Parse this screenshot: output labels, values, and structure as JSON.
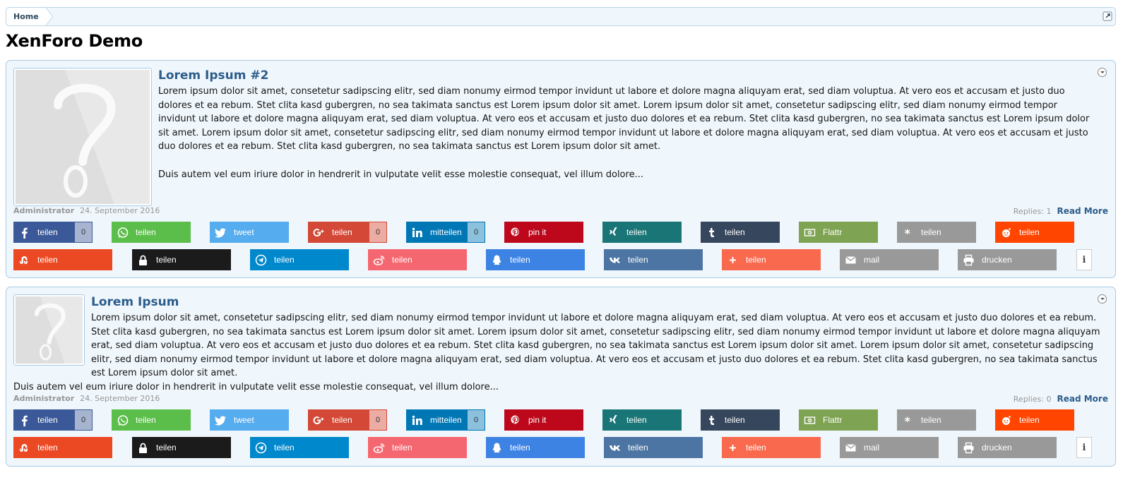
{
  "breadcrumb": {
    "home": "Home"
  },
  "page_title": "XenForo Demo",
  "colors": {
    "facebook": "#3b5998",
    "whatsapp": "#5cbe4a",
    "twitter": "#55acee",
    "googleplus": "#d34836",
    "linkedin": "#0077b5",
    "pinterest": "#bd081c",
    "xing": "#1a7576",
    "tumblr": "#36465d",
    "flattr": "#7ea352",
    "diaspora": "#999999",
    "reddit": "#ff4500",
    "stumbleupon": "#eb4924",
    "threema": "#1b1b1b",
    "telegram": "#0088cc",
    "weibo": "#f56770",
    "qq": "#3d83e4",
    "vk": "#4c75a3",
    "addthis": "#f8694d",
    "mail": "#999999",
    "print": "#999999"
  },
  "share_buttons_row1": [
    {
      "name": "facebook",
      "icon": "facebook-icon",
      "label": "teilen",
      "count": "0"
    },
    {
      "name": "whatsapp",
      "icon": "whatsapp-icon",
      "label": "teilen"
    },
    {
      "name": "twitter",
      "icon": "twitter-icon",
      "label": "tweet"
    },
    {
      "name": "googleplus",
      "icon": "googleplus-icon",
      "label": "teilen",
      "count": "0"
    },
    {
      "name": "linkedin",
      "icon": "linkedin-icon",
      "label": "mitteilen",
      "count": "0"
    },
    {
      "name": "pinterest",
      "icon": "pinterest-icon",
      "label": "pin it"
    },
    {
      "name": "xing",
      "icon": "xing-icon",
      "label": "teilen"
    },
    {
      "name": "tumblr",
      "icon": "tumblr-icon",
      "label": "teilen"
    },
    {
      "name": "flattr",
      "icon": "flattr-icon",
      "label": "Flattr"
    },
    {
      "name": "diaspora",
      "icon": "diaspora-icon",
      "label": "teilen"
    },
    {
      "name": "reddit",
      "icon": "reddit-icon",
      "label": "teilen"
    }
  ],
  "share_buttons_row2": [
    {
      "name": "stumbleupon",
      "icon": "stumbleupon-icon",
      "label": "teilen"
    },
    {
      "name": "threema",
      "icon": "lock-icon",
      "label": "teilen"
    },
    {
      "name": "telegram",
      "icon": "telegram-icon",
      "label": "teilen"
    },
    {
      "name": "weibo",
      "icon": "weibo-icon",
      "label": "teilen"
    },
    {
      "name": "qq",
      "icon": "qq-icon",
      "label": "teilen"
    },
    {
      "name": "vk",
      "icon": "vk-icon",
      "label": "teilen"
    },
    {
      "name": "addthis",
      "icon": "plus-icon",
      "label": "teilen"
    },
    {
      "name": "mail",
      "icon": "mail-icon",
      "label": "mail"
    },
    {
      "name": "print",
      "icon": "print-icon",
      "label": "drucken"
    }
  ],
  "info_button": "i",
  "posts": [
    {
      "title": "Lorem Ipsum #2",
      "paragraph1": "Lorem ipsum dolor sit amet, consetetur sadipscing elitr, sed diam nonumy eirmod tempor invidunt ut labore et dolore magna aliquyam erat, sed diam voluptua. At vero eos et accusam et justo duo dolores et ea rebum. Stet clita kasd gubergren, no sea takimata sanctus est Lorem ipsum dolor sit amet. Lorem ipsum dolor sit amet, consetetur sadipscing elitr, sed diam nonumy eirmod tempor invidunt ut labore et dolore magna aliquyam erat, sed diam voluptua. At vero eos et accusam et justo duo dolores et ea rebum. Stet clita kasd gubergren, no sea takimata sanctus est Lorem ipsum dolor sit amet. Lorem ipsum dolor sit amet, consetetur sadipscing elitr, sed diam nonumy eirmod tempor invidunt ut labore et dolore magna aliquyam erat, sed diam voluptua. At vero eos et accusam et justo duo dolores et ea rebum. Stet clita kasd gubergren, no sea takimata sanctus est Lorem ipsum dolor sit amet.",
      "paragraph2": "Duis autem vel eum iriure dolor in hendrerit in vulputate velit esse molestie consequat, vel illum dolore...",
      "author": "Administrator",
      "date": "24. September 2016",
      "replies": "Replies: 1",
      "read_more": "Read More"
    },
    {
      "title": "Lorem Ipsum",
      "paragraph1": "Lorem ipsum dolor sit amet, consetetur sadipscing elitr, sed diam nonumy eirmod tempor invidunt ut labore et dolore magna aliquyam erat, sed diam voluptua. At vero eos et accusam et justo duo dolores et ea rebum. Stet clita kasd gubergren, no sea takimata sanctus est Lorem ipsum dolor sit amet. Lorem ipsum dolor sit amet, consetetur sadipscing elitr, sed diam nonumy eirmod tempor invidunt ut labore et dolore magna aliquyam erat, sed diam voluptua. At vero eos et accusam et justo duo dolores et ea rebum. Stet clita kasd gubergren, no sea takimata sanctus est Lorem ipsum dolor sit amet. Lorem ipsum dolor sit amet, consetetur sadipscing elitr, sed diam nonumy eirmod tempor invidunt ut labore et dolore magna aliquyam erat, sed diam voluptua. At vero eos et accusam et justo duo dolores et ea rebum. Stet clita kasd gubergren, no sea takimata sanctus est Lorem ipsum dolor sit amet.",
      "paragraph2": "Duis autem vel eum iriure dolor in hendrerit in vulputate velit esse molestie consequat, vel illum dolore...",
      "author": "Administrator",
      "date": "24. September 2016",
      "replies": "Replies: 0",
      "read_more": "Read More"
    }
  ]
}
